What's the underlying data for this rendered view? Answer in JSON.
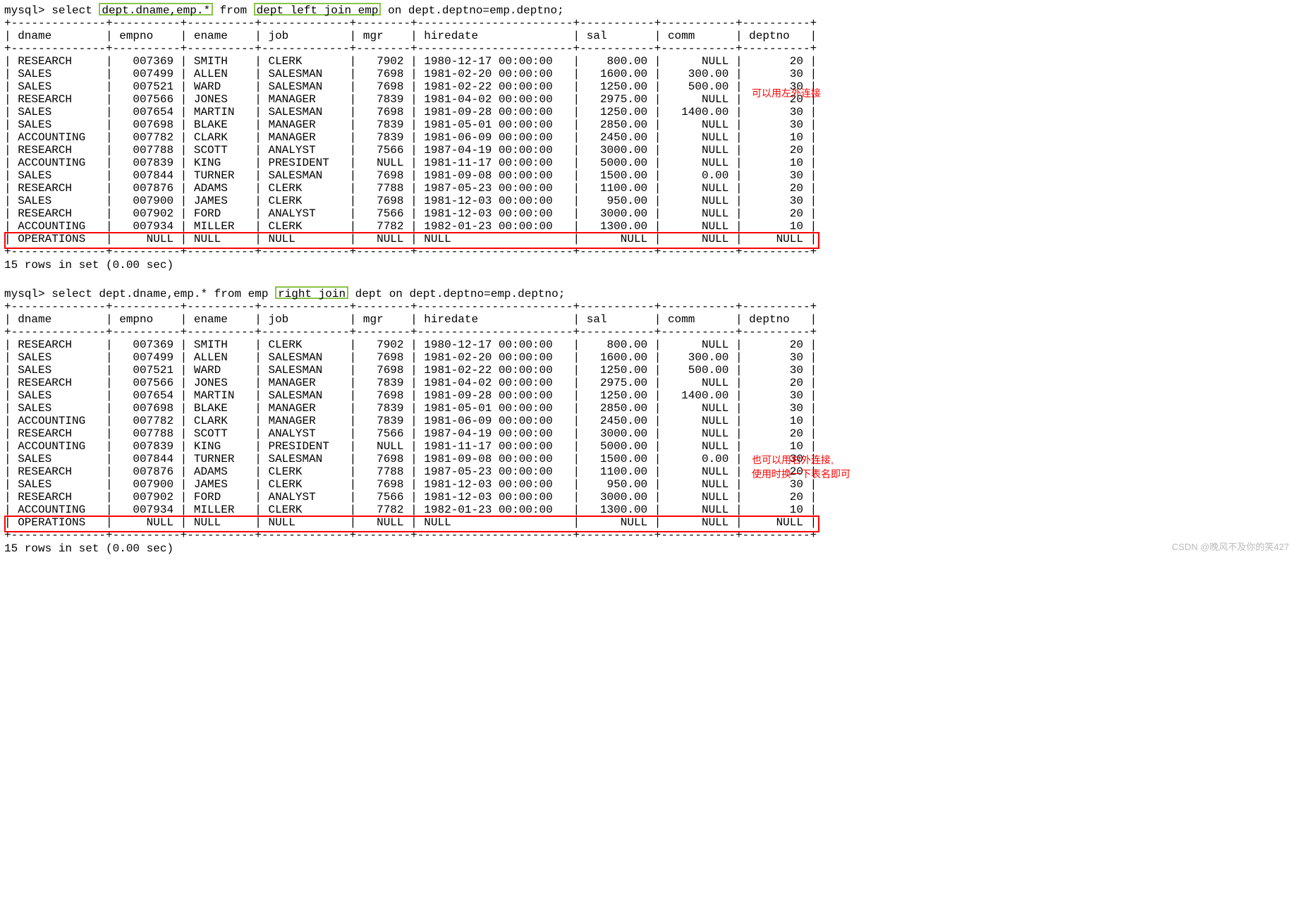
{
  "query1": {
    "prompt": "mysql> select ",
    "sel": "dept.dname,emp.*",
    "from_kw": " from ",
    "join_part": "dept left join emp",
    "rest": " on dept.deptno=emp.deptno;"
  },
  "query2": {
    "prompt": "mysql> select dept.dname,emp.* from emp ",
    "join_part": "right join",
    "rest": " dept on dept.deptno=emp.deptno;"
  },
  "cols": [
    "dname",
    "empno",
    "ename",
    "job",
    "mgr",
    "hiredate",
    "sal",
    "comm",
    "deptno"
  ],
  "widths": [
    12,
    8,
    8,
    11,
    6,
    21,
    9,
    9,
    8
  ],
  "aligns": [
    "L",
    "R",
    "L",
    "L",
    "R",
    "L",
    "R",
    "R",
    "R"
  ],
  "rows": [
    [
      "RESEARCH",
      "007369",
      "SMITH",
      "CLERK",
      "7902",
      "1980-12-17 00:00:00",
      "800.00",
      "NULL",
      "20"
    ],
    [
      "SALES",
      "007499",
      "ALLEN",
      "SALESMAN",
      "7698",
      "1981-02-20 00:00:00",
      "1600.00",
      "300.00",
      "30"
    ],
    [
      "SALES",
      "007521",
      "WARD",
      "SALESMAN",
      "7698",
      "1981-02-22 00:00:00",
      "1250.00",
      "500.00",
      "30"
    ],
    [
      "RESEARCH",
      "007566",
      "JONES",
      "MANAGER",
      "7839",
      "1981-04-02 00:00:00",
      "2975.00",
      "NULL",
      "20"
    ],
    [
      "SALES",
      "007654",
      "MARTIN",
      "SALESMAN",
      "7698",
      "1981-09-28 00:00:00",
      "1250.00",
      "1400.00",
      "30"
    ],
    [
      "SALES",
      "007698",
      "BLAKE",
      "MANAGER",
      "7839",
      "1981-05-01 00:00:00",
      "2850.00",
      "NULL",
      "30"
    ],
    [
      "ACCOUNTING",
      "007782",
      "CLARK",
      "MANAGER",
      "7839",
      "1981-06-09 00:00:00",
      "2450.00",
      "NULL",
      "10"
    ],
    [
      "RESEARCH",
      "007788",
      "SCOTT",
      "ANALYST",
      "7566",
      "1987-04-19 00:00:00",
      "3000.00",
      "NULL",
      "20"
    ],
    [
      "ACCOUNTING",
      "007839",
      "KING",
      "PRESIDENT",
      "NULL",
      "1981-11-17 00:00:00",
      "5000.00",
      "NULL",
      "10"
    ],
    [
      "SALES",
      "007844",
      "TURNER",
      "SALESMAN",
      "7698",
      "1981-09-08 00:00:00",
      "1500.00",
      "0.00",
      "30"
    ],
    [
      "RESEARCH",
      "007876",
      "ADAMS",
      "CLERK",
      "7788",
      "1987-05-23 00:00:00",
      "1100.00",
      "NULL",
      "20"
    ],
    [
      "SALES",
      "007900",
      "JAMES",
      "CLERK",
      "7698",
      "1981-12-03 00:00:00",
      "950.00",
      "NULL",
      "30"
    ],
    [
      "RESEARCH",
      "007902",
      "FORD",
      "ANALYST",
      "7566",
      "1981-12-03 00:00:00",
      "3000.00",
      "NULL",
      "20"
    ],
    [
      "ACCOUNTING",
      "007934",
      "MILLER",
      "CLERK",
      "7782",
      "1982-01-23 00:00:00",
      "1300.00",
      "NULL",
      "10"
    ],
    [
      "OPERATIONS",
      "NULL",
      "NULL",
      "NULL",
      "NULL",
      "NULL",
      "NULL",
      "NULL",
      "NULL"
    ]
  ],
  "footer": "15 rows in set (0.00 sec)",
  "annotations": {
    "a1": "可以用左外连接",
    "a2_l1": "也可以用右外连接,",
    "a2_l2": "使用时换一下表名即可"
  },
  "watermark": "CSDN @晚风不及你的笑427",
  "chart_data": {
    "type": "table",
    "columns": [
      "dname",
      "empno",
      "ename",
      "job",
      "mgr",
      "hiredate",
      "sal",
      "comm",
      "deptno"
    ],
    "rows": [
      [
        "RESEARCH",
        "007369",
        "SMITH",
        "CLERK",
        "7902",
        "1980-12-17 00:00:00",
        "800.00",
        "NULL",
        "20"
      ],
      [
        "SALES",
        "007499",
        "ALLEN",
        "SALESMAN",
        "7698",
        "1981-02-20 00:00:00",
        "1600.00",
        "300.00",
        "30"
      ],
      [
        "SALES",
        "007521",
        "WARD",
        "SALESMAN",
        "7698",
        "1981-02-22 00:00:00",
        "1250.00",
        "500.00",
        "30"
      ],
      [
        "RESEARCH",
        "007566",
        "JONES",
        "MANAGER",
        "7839",
        "1981-04-02 00:00:00",
        "2975.00",
        "NULL",
        "20"
      ],
      [
        "SALES",
        "007654",
        "MARTIN",
        "SALESMAN",
        "7698",
        "1981-09-28 00:00:00",
        "1250.00",
        "1400.00",
        "30"
      ],
      [
        "SALES",
        "007698",
        "BLAKE",
        "MANAGER",
        "7839",
        "1981-05-01 00:00:00",
        "2850.00",
        "NULL",
        "30"
      ],
      [
        "ACCOUNTING",
        "007782",
        "CLARK",
        "MANAGER",
        "7839",
        "1981-06-09 00:00:00",
        "2450.00",
        "NULL",
        "10"
      ],
      [
        "RESEARCH",
        "007788",
        "SCOTT",
        "ANALYST",
        "7566",
        "1987-04-19 00:00:00",
        "3000.00",
        "NULL",
        "20"
      ],
      [
        "ACCOUNTING",
        "007839",
        "KING",
        "PRESIDENT",
        "NULL",
        "1981-11-17 00:00:00",
        "5000.00",
        "NULL",
        "10"
      ],
      [
        "SALES",
        "007844",
        "TURNER",
        "SALESMAN",
        "7698",
        "1981-09-08 00:00:00",
        "1500.00",
        "0.00",
        "30"
      ],
      [
        "RESEARCH",
        "007876",
        "ADAMS",
        "CLERK",
        "7788",
        "1987-05-23 00:00:00",
        "1100.00",
        "NULL",
        "20"
      ],
      [
        "SALES",
        "007900",
        "JAMES",
        "CLERK",
        "7698",
        "1981-12-03 00:00:00",
        "950.00",
        "NULL",
        "30"
      ],
      [
        "RESEARCH",
        "007902",
        "FORD",
        "ANALYST",
        "7566",
        "1981-12-03 00:00:00",
        "3000.00",
        "NULL",
        "20"
      ],
      [
        "ACCOUNTING",
        "007934",
        "MILLER",
        "CLERK",
        "7782",
        "1982-01-23 00:00:00",
        "1300.00",
        "NULL",
        "10"
      ],
      [
        "OPERATIONS",
        "NULL",
        "NULL",
        "NULL",
        "NULL",
        "NULL",
        "NULL",
        "NULL",
        "NULL"
      ]
    ]
  }
}
